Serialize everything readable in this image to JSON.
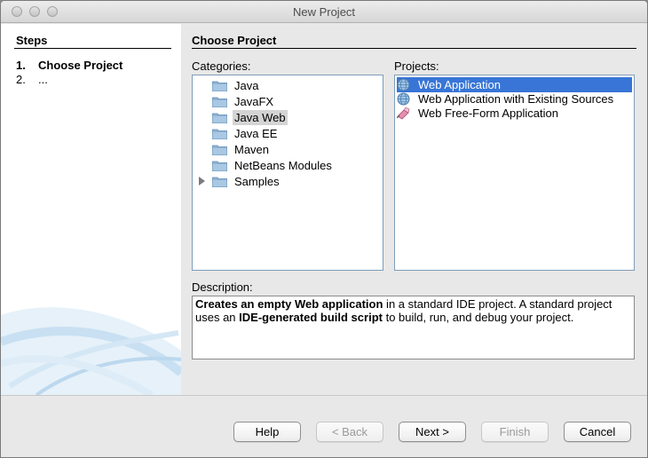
{
  "window": {
    "title": "New Project"
  },
  "steps": {
    "title": "Steps",
    "items": [
      {
        "num": "1.",
        "label": "Choose Project"
      },
      {
        "num": "2.",
        "label": "..."
      }
    ]
  },
  "main": {
    "heading": "Choose Project",
    "categories_label": "Categories:",
    "projects_label": "Projects:",
    "description_label": "Description:",
    "categories": [
      {
        "label": "Java"
      },
      {
        "label": "JavaFX"
      },
      {
        "label": "Java Web",
        "selected": true
      },
      {
        "label": "Java EE"
      },
      {
        "label": "Maven"
      },
      {
        "label": "NetBeans Modules"
      },
      {
        "label": "Samples",
        "expandable": true
      }
    ],
    "projects": [
      {
        "label": "Web Application",
        "icon": "globe-icon",
        "selected": true
      },
      {
        "label": "Web Application with Existing Sources",
        "icon": "globe-icon"
      },
      {
        "label": "Web Free-Form Application",
        "icon": "free-form-icon"
      }
    ],
    "description": {
      "parts": [
        {
          "text": "Creates an empty Web application",
          "bold": true
        },
        {
          "text": " in a standard IDE project. A standard project uses an ",
          "bold": false
        },
        {
          "text": "IDE-generated build script",
          "bold": true
        },
        {
          "text": " to build, run, and debug your project.",
          "bold": false
        }
      ]
    }
  },
  "buttons": {
    "help": "Help",
    "back": "< Back",
    "next": "Next >",
    "finish": "Finish",
    "cancel": "Cancel"
  },
  "colors": {
    "selection": "#3875d7",
    "category_highlight": "#d4d4d4",
    "folder": "#8fb4d6"
  }
}
